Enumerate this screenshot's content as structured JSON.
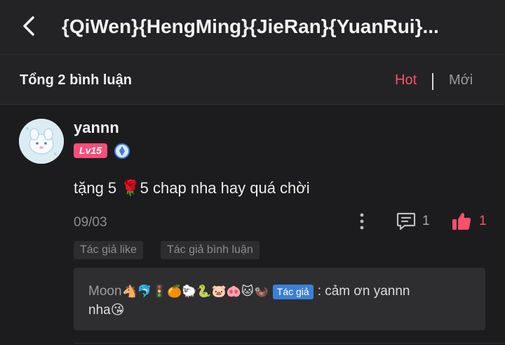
{
  "header": {
    "title": "{QiWen}{HengMing}{JieRan}{YuanRui}..."
  },
  "comments_bar": {
    "total": "Tổng 2 bình luận",
    "sort_hot": "Hot",
    "sort_new": "Mới",
    "active_color": "#ff4f6d"
  },
  "comment": {
    "username": "yannn",
    "level": "Lv15",
    "content": "tặng 5 🌹5 chap nha hay quá chời",
    "date": "09/03",
    "reply_count": "1",
    "like_count": "1",
    "tags": [
      "Tác giả like",
      "Tác giả bình luận"
    ],
    "reply": {
      "name": "Moon",
      "emojis": "🐴🐬🚦🍊🐑🐍🐷🐽🐱🦦",
      "author_tag": "Tác giả",
      "text_line1": ": cảm ơn yannn",
      "text_line2": "nha😘"
    }
  }
}
